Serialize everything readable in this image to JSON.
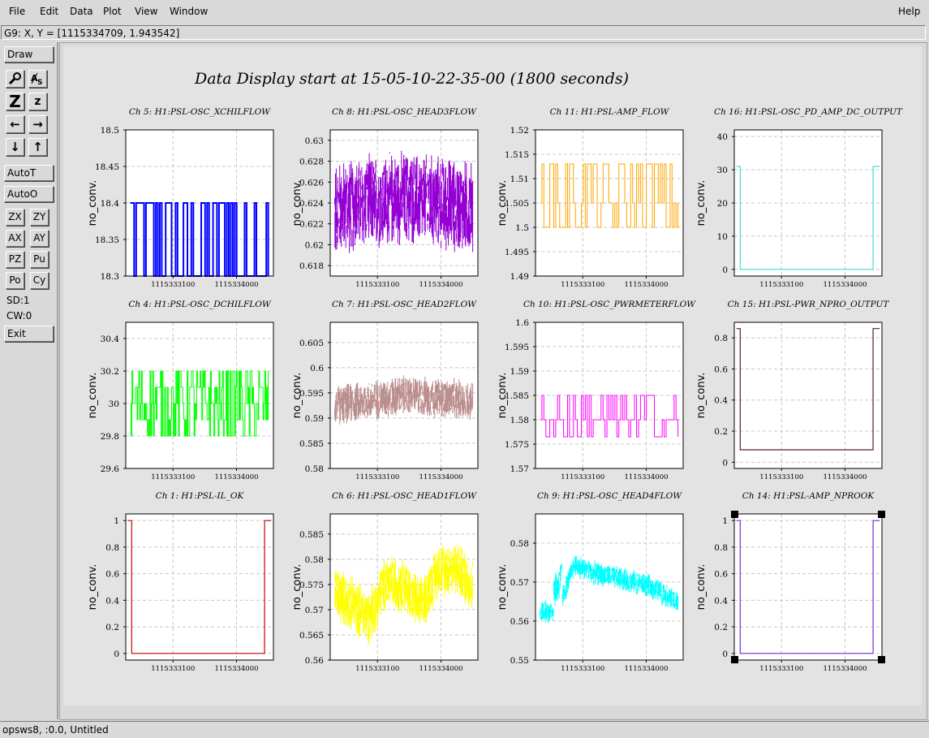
{
  "menu": {
    "file": "File",
    "edit": "Edit",
    "data": "Data",
    "plot": "Plot",
    "view": "View",
    "window": "Window",
    "help": "Help"
  },
  "coord_readout": "G9: X, Y = [1115334709, 1.943542]",
  "toolbar": {
    "draw": "Draw",
    "icons": [
      "magnifier-icon",
      "text-scale-icon",
      "zoom-Z-large-icon",
      "zoom-z-small-icon",
      "arrow-left-icon",
      "arrow-right-icon",
      "arrow-down-icon",
      "arrow-up-icon"
    ],
    "autot": "AutoT",
    "autoo": "AutoO",
    "zx": "ZX",
    "zy": "ZY",
    "ax": "AX",
    "ay": "AY",
    "pz": "PZ",
    "pu": "Pu",
    "po": "Po",
    "cy": "Cy",
    "sd": "SD:1",
    "cw": "CW:0",
    "exit": "Exit"
  },
  "title": "Data Display start at 15-05-10-22-35-00 (1800 seconds)",
  "status": "opsws8, :0.0, Untitled",
  "chart_data": [
    {
      "type": "line",
      "title": "Ch 5: H1:PSL-OSC_XCHILFLOW",
      "ylabel": "no_conv.",
      "x_ticks": [
        "1115333100",
        "1115334000"
      ],
      "y_ticks": [
        "18.5",
        "18.45",
        "18.4",
        "18.35",
        "18.3"
      ],
      "ylim": [
        18.3,
        18.5
      ],
      "color": "#0000ff",
      "pattern": "two-level",
      "levels": [
        18.3,
        18.4
      ],
      "grid": true
    },
    {
      "type": "line",
      "title": "Ch 8: H1:PSL-OSC_HEAD3FLOW",
      "ylabel": "no_conv.",
      "x_ticks": [
        "1115333100",
        "1115334000"
      ],
      "y_ticks": [
        "0.63",
        "0.628",
        "0.626",
        "0.624",
        "0.622",
        "0.62",
        "0.618"
      ],
      "ylim": [
        0.617,
        0.631
      ],
      "color": "#9400d3",
      "pattern": "noise",
      "center": [
        0.6235,
        0.6245,
        0.6235
      ],
      "spread": 0.0045,
      "grid": true
    },
    {
      "type": "line",
      "title": "Ch 11: H1:PSL-AMP_FLOW",
      "ylabel": "no_conv.",
      "x_ticks": [
        "1115333100",
        "1115334000"
      ],
      "y_ticks": [
        "1.52",
        "1.515",
        "1.51",
        "1.505",
        "1.5",
        "1.495",
        "1.49"
      ],
      "ylim": [
        1.49,
        1.52
      ],
      "color": "#ffa500",
      "pattern": "two-level",
      "levels": [
        1.5,
        1.505,
        1.513
      ],
      "grid": true
    },
    {
      "type": "line",
      "title": "Ch 16: H1:PSL-OSC_PD_AMP_DC_OUTPUT",
      "ylabel": "no_conv.",
      "x_ticks": [
        "1115333100",
        "1115334000"
      ],
      "y_ticks": [
        "40",
        "30",
        "20",
        "10",
        "0"
      ],
      "ylim": [
        -2,
        42
      ],
      "color": "#40e0d0",
      "pattern": "step",
      "levels": [
        31,
        0,
        31
      ],
      "grid": true
    },
    {
      "type": "line",
      "title": "Ch 4: H1:PSL-OSC_DCHILFLOW",
      "ylabel": "no_conv.",
      "x_ticks": [
        "1115333100",
        "1115334000"
      ],
      "y_ticks": [
        "30.4",
        "30.2",
        "30",
        "29.8",
        "29.6"
      ],
      "ylim": [
        29.6,
        30.5
      ],
      "color": "#00ff00",
      "pattern": "multi-level",
      "levels": [
        29.8,
        29.9,
        30.0,
        30.1,
        30.2
      ],
      "grid": true
    },
    {
      "type": "line",
      "title": "Ch 7: H1:PSL-OSC_HEAD2FLOW",
      "ylabel": "no_conv.",
      "x_ticks": [
        "1115333100",
        "1115334000"
      ],
      "y_ticks": [
        "0.605",
        "0.6",
        "0.595",
        "0.59",
        "0.585",
        "0.58"
      ],
      "ylim": [
        0.58,
        0.609
      ],
      "color": "#bc8f8f",
      "pattern": "noise",
      "center": [
        0.5925,
        0.5945,
        0.5935
      ],
      "spread": 0.004,
      "grid": true
    },
    {
      "type": "line",
      "title": "Ch 10: H1:PSL-OSC_PWRMETERFLOW",
      "ylabel": "no_conv.",
      "x_ticks": [
        "1115333100",
        "1115334000"
      ],
      "y_ticks": [
        "1.6",
        "1.595",
        "1.59",
        "1.585",
        "1.58",
        "1.575",
        "1.57"
      ],
      "ylim": [
        1.57,
        1.6
      ],
      "color": "#ff00ff",
      "pattern": "two-level",
      "levels": [
        1.5765,
        1.58,
        1.585
      ],
      "grid": true
    },
    {
      "type": "line",
      "title": "Ch 15: H1:PSL-PWR_NPRO_OUTPUT",
      "ylabel": "no_conv.",
      "x_ticks": [
        "1115333100",
        "1115334000"
      ],
      "y_ticks": [
        "0.8",
        "0.6",
        "0.4",
        "0.2",
        "0"
      ],
      "ylim": [
        -0.04,
        0.9
      ],
      "color": "#5a1a3a",
      "pattern": "step",
      "levels": [
        0.86,
        0.08,
        0.86
      ],
      "grid": true
    },
    {
      "type": "line",
      "title": "Ch 1: H1:PSL-IL_OK",
      "ylabel": "no_conv.",
      "x_ticks": [
        "1115333100",
        "1115334000"
      ],
      "y_ticks": [
        "1",
        "0.8",
        "0.6",
        "0.4",
        "0.2",
        "0"
      ],
      "ylim": [
        -0.05,
        1.05
      ],
      "color": "#cc0000",
      "pattern": "step",
      "levels": [
        1,
        0,
        1
      ],
      "grid": true
    },
    {
      "type": "line",
      "title": "Ch 6: H1:PSL-OSC_HEAD1FLOW",
      "ylabel": "no_conv.",
      "x_ticks": [
        "1115333100",
        "1115334000"
      ],
      "y_ticks": [
        "0.585",
        "0.58",
        "0.575",
        "0.57",
        "0.565",
        "0.56"
      ],
      "ylim": [
        0.56,
        0.589
      ],
      "color": "#ffff00",
      "pattern": "noise",
      "center": [
        0.5735,
        0.571,
        0.5685,
        0.5755,
        0.575,
        0.5705,
        0.578,
        0.5785,
        0.5745
      ],
      "spread": 0.0055,
      "grid": true
    },
    {
      "type": "line",
      "title": "Ch 9: H1:PSL-OSC_HEAD4FLOW",
      "ylabel": "no_conv.",
      "x_ticks": [
        "1115333100",
        "1115334000"
      ],
      "y_ticks": [
        "0.58",
        "0.57",
        "0.56",
        "0.55"
      ],
      "ylim": [
        0.55,
        0.5875
      ],
      "color": "#00ffff",
      "pattern": "decay",
      "center": [
        0.5625,
        0.5625,
        0.5745,
        0.5725,
        0.5715,
        0.5705,
        0.5695,
        0.5675,
        0.5645
      ],
      "spread": 0.003,
      "grid": true
    },
    {
      "type": "line",
      "title": "Ch 14: H1:PSL-AMP_NPROOK",
      "ylabel": "no_conv.",
      "x_ticks": [
        "1115333100",
        "1115334000"
      ],
      "y_ticks": [
        "1",
        "0.8",
        "0.6",
        "0.4",
        "0.2",
        "0"
      ],
      "ylim": [
        -0.05,
        1.05
      ],
      "color": "#7b2bdb",
      "pattern": "step",
      "levels": [
        1,
        0,
        1
      ],
      "grid": true,
      "selected": true
    }
  ]
}
